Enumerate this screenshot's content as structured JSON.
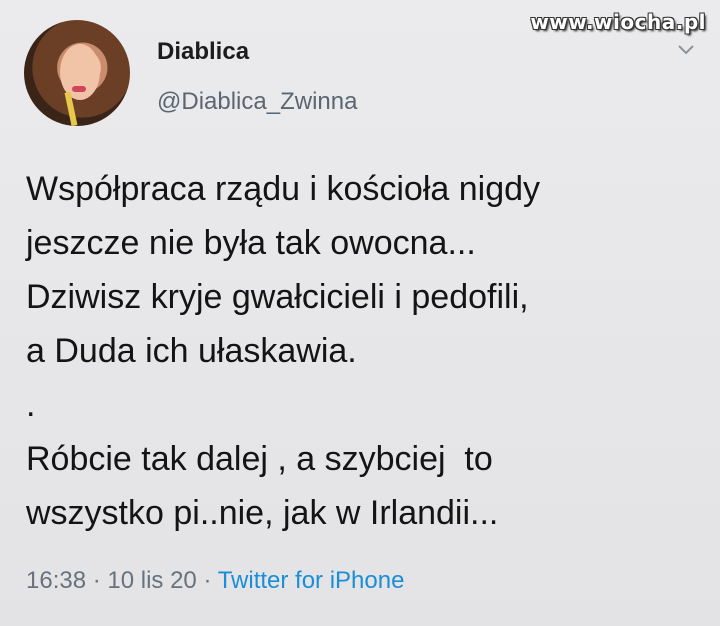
{
  "watermark": "www.wiocha.pl",
  "user": {
    "display_name": "Diablica",
    "handle": "@Diablica_Zwinna"
  },
  "tweet": {
    "lines": [
      "Współpraca rządu i kościoła nigdy",
      "jeszcze nie była tak owocna...",
      "Dziwisz kryje gwałcicieli i pedofili,",
      "a Duda ich ułaskawia.",
      ".",
      "Róbcie tak dalej , a szybciej  to",
      "wszystko pi..nie, jak w Irlandii..."
    ]
  },
  "meta": {
    "time": "16:38",
    "sep1": " · ",
    "date": "10 lis 20",
    "sep2": " · ",
    "source": "Twitter for iPhone"
  },
  "icons": {
    "menu": "chevron-down-icon"
  },
  "colors": {
    "source_link": "#1b8ed8",
    "meta_text": "#67727c"
  }
}
